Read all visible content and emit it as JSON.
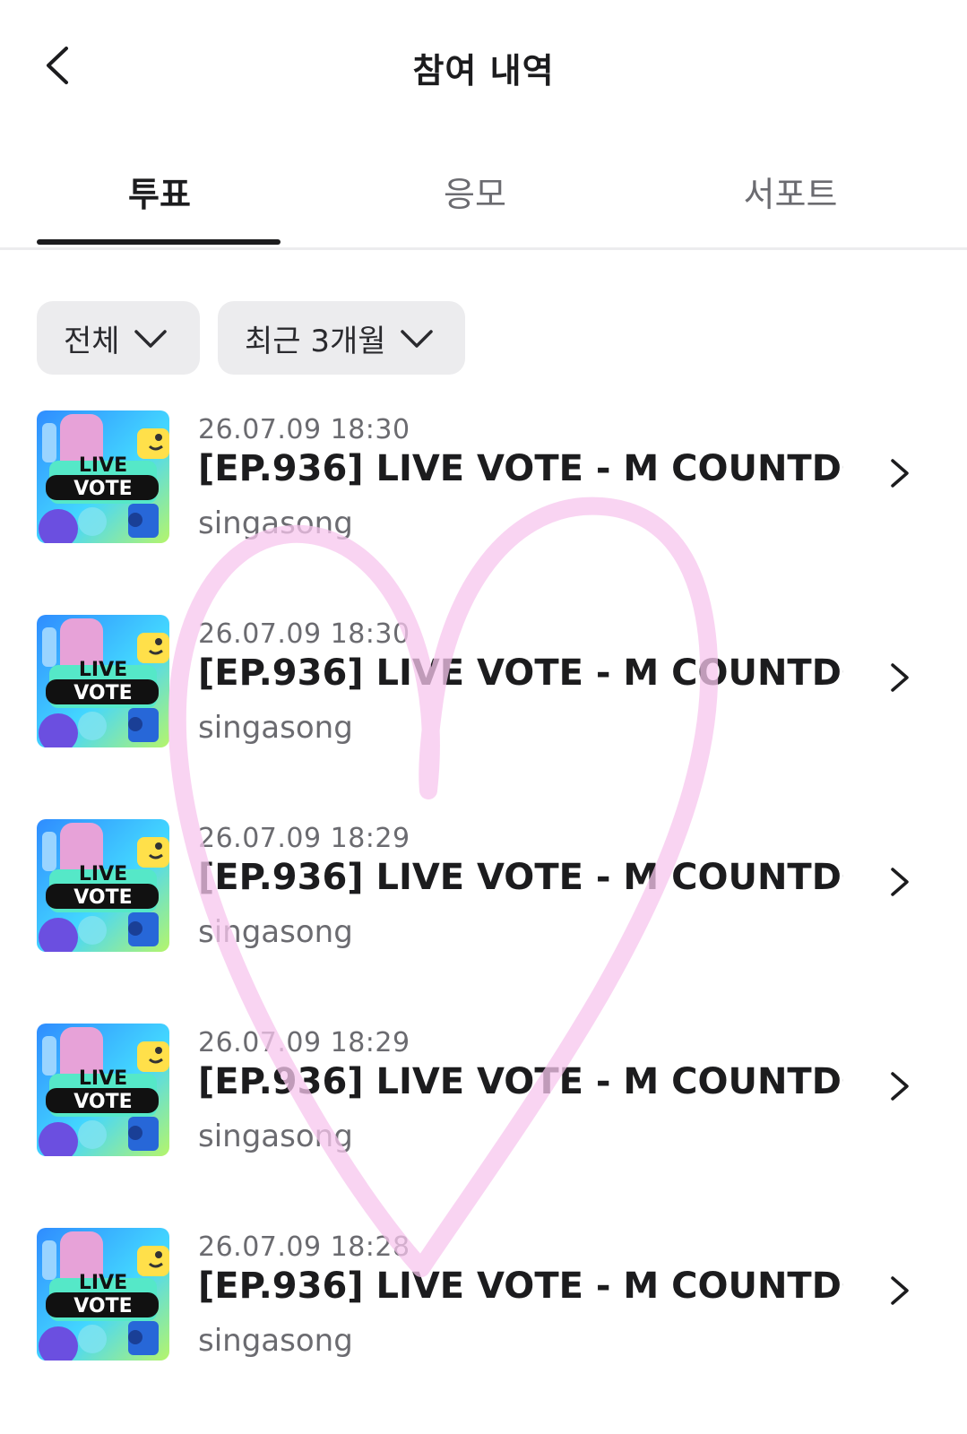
{
  "header": {
    "title": "참여 내역",
    "back_icon": "chevron-left-icon"
  },
  "tabs": [
    {
      "label": "투표",
      "active": true
    },
    {
      "label": "응모",
      "active": false
    },
    {
      "label": "서포트",
      "active": false
    }
  ],
  "filters": [
    {
      "label": "전체",
      "icon": "chevron-down-icon"
    },
    {
      "label": "최근 3개월",
      "icon": "chevron-down-icon"
    }
  ],
  "thumbnail_text": {
    "line1": "LIVE",
    "line2": "VOTE"
  },
  "items": [
    {
      "date": "26.07.09 18:30",
      "title": "[EP.936] LIVE VOTE - M COUNTDO...",
      "artist": "singasong"
    },
    {
      "date": "26.07.09 18:30",
      "title": "[EP.936] LIVE VOTE - M COUNTDO...",
      "artist": "singasong"
    },
    {
      "date": "26.07.09 18:29",
      "title": "[EP.936] LIVE VOTE - M COUNTDO...",
      "artist": "singasong"
    },
    {
      "date": "26.07.09 18:29",
      "title": "[EP.936] LIVE VOTE - M COUNTDO...",
      "artist": "singasong"
    },
    {
      "date": "26.07.09 18:28",
      "title": "[EP.936] LIVE VOTE - M COUNTDO...",
      "artist": "singasong"
    }
  ],
  "colors": {
    "text": "#1c1c1e",
    "muted": "#6b6b70",
    "chip_bg": "#ececee",
    "heart": "#f7c6ee"
  }
}
